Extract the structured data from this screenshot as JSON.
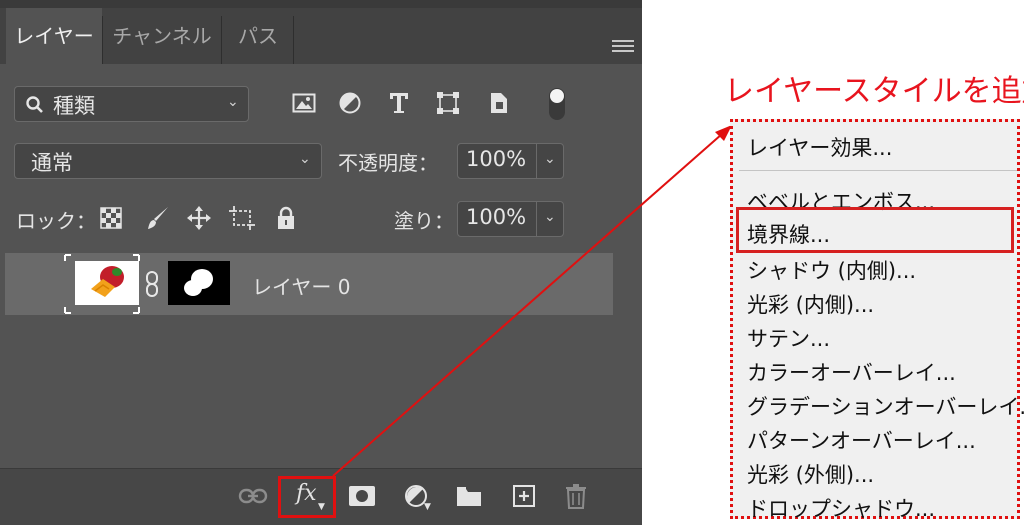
{
  "tabs": [
    "レイヤー",
    "チャンネル",
    "パス"
  ],
  "filter": {
    "label": "種類"
  },
  "blend": {
    "mode": "通常",
    "opacity_label": "不透明度：",
    "opacity_value": "100%"
  },
  "lock": {
    "label": "ロック：",
    "fill_label": "塗り：",
    "fill_value": "100%"
  },
  "layer": {
    "name": "レイヤー 0"
  },
  "bottom": {
    "fx_label": "fx"
  },
  "callout": {
    "title": "レイヤースタイルを追加"
  },
  "menu": {
    "items": [
      "レイヤー効果...",
      "ベベルとエンボス...",
      "境界線...",
      "シャドウ (内側)...",
      "光彩 (内側)...",
      "サテン...",
      "カラーオーバーレイ...",
      "グラデーションオーバーレイ...",
      "パターンオーバーレイ...",
      "光彩 (外側)...",
      "ドロップシャドウ..."
    ]
  },
  "colors": {
    "annotation": "#e01010",
    "panel_bg": "#535353"
  },
  "icons": [
    "search-icon",
    "image-filter-icon",
    "adjustment-filter-icon",
    "type-filter-icon",
    "shape-filter-icon",
    "smartobject-filter-icon",
    "filter-toggle-icon",
    "lock-transparent-icon",
    "lock-brush-icon",
    "lock-move-icon",
    "lock-artboard-icon",
    "lock-all-icon",
    "eye-icon",
    "chain-icon",
    "link-icon",
    "mask-icon",
    "adjustment-icon",
    "folder-icon",
    "new-layer-icon",
    "trash-icon"
  ]
}
